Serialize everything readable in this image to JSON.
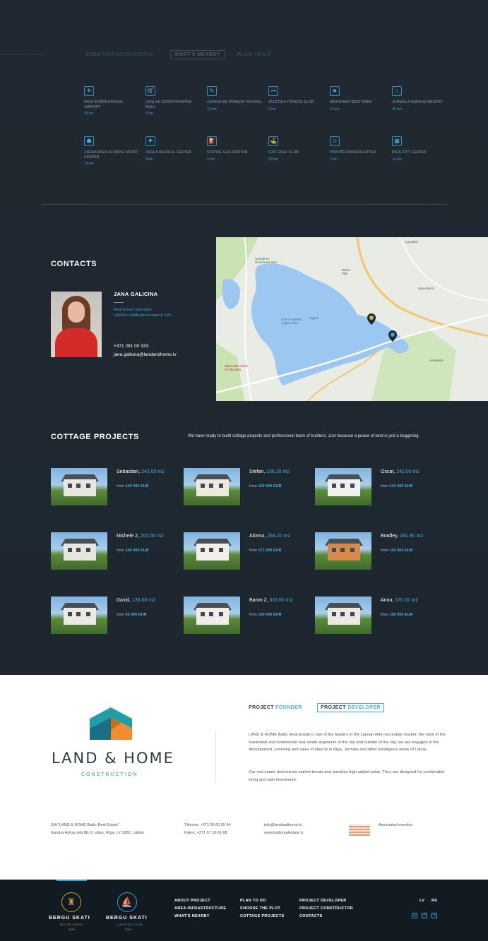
{
  "tabs": [
    {
      "label_a": "AREA",
      "label_b": "INFRASTRUCTURE"
    },
    {
      "label_a": "WHAT'S NEARBY"
    },
    {
      "label_a": "PLAN",
      "label_b": "TO DO"
    }
  ],
  "nearby": [
    {
      "icon": "airplane-icon",
      "glyph": "✈",
      "name": "RIGA INTERNATIONAL AIRPORT",
      "distance": "20 km"
    },
    {
      "icon": "shopping-cart-icon",
      "glyph": "🛒",
      "name": "JUGLAS CENTR SHOPING MALL",
      "distance": "5 km"
    },
    {
      "icon": "school-icon",
      "glyph": "✎",
      "name": "GARKALNE PRIMARY SCHOOL",
      "distance": "13 km"
    },
    {
      "icon": "dumbbell-icon",
      "glyph": "⊶",
      "name": "ATLETIKA FITNESS CLUB",
      "distance": "5 km"
    },
    {
      "icon": "tree-icon",
      "glyph": "♣",
      "name": "MEZAPARK REST PARK",
      "distance": "10 km"
    },
    {
      "icon": "resort-icon",
      "glyph": "⌂",
      "name": "JURMALA FAMOUS RESORT",
      "distance": "35 km"
    },
    {
      "icon": "stadium-icon",
      "glyph": "☗",
      "name": "ARENA RIGA OLYMPIC SPORT CENTER",
      "distance": "15 km"
    },
    {
      "icon": "medical-cross-icon",
      "glyph": "✚",
      "name": "JUGLA MEDICAL CENTER",
      "distance": "5 km"
    },
    {
      "icon": "gas-station-icon",
      "glyph": "⛽",
      "name": "STATOIL GAS STATION",
      "distance": "3 km"
    },
    {
      "icon": "golf-icon",
      "glyph": "⛳",
      "name": "OZO GOLF CLUB",
      "distance": "30 km"
    },
    {
      "icon": "kindergarten-icon",
      "glyph": "☺",
      "name": "PRIVATE KINDERGARTEN",
      "distance": "2 km"
    },
    {
      "icon": "city-icon",
      "glyph": "▦",
      "name": "RIGA CITY CENTER",
      "distance": "14 km"
    }
  ],
  "contacts": {
    "heading": "CONTACTS",
    "name": "JANA GALICINA",
    "role": "Real Estate Specialist",
    "certificate": "LANIDA certificate number A-139",
    "phone": "+371 281 00 333",
    "email": "jana.galicina@landandhome.lv"
  },
  "map": {
    "labels": {
      "pin_a": "Garkalnes\nskriešanas taka",
      "bay": "Ūdens kaisība\nJuglas ezers",
      "lake": "Juglas",
      "gauss": "Gaujas\nezers",
      "pin_b": "Biķernieku mežs\nSmilšu taka",
      "berzu": "Bērzu\nŠķiļi",
      "upesciems": "Upesciems",
      "amatnieki": "Amatnieki",
      "langstini": "Langstiņi"
    }
  },
  "cottage": {
    "heading": "COTTAGE PROJECTS",
    "intro": "We have ready to build cottage projects and professional team of builders. Just because a peace of land is just a beggining.",
    "from_label": "from",
    "projects": [
      {
        "name": "Sebastian,",
        "area": "242.00 m2",
        "price": "145 000 EUR"
      },
      {
        "name": "Stefan,",
        "area": "236.20 m2",
        "price": "142 000 EUR"
      },
      {
        "name": "Oscar,",
        "area": "242.00 m2",
        "price": "141 000 EUR"
      },
      {
        "name": "Michele 2,",
        "area": "253.50 m2",
        "price": "145 000 EUR"
      },
      {
        "name": "Alonso,",
        "area": "284.20 m2",
        "price": "171 000 EUR"
      },
      {
        "name": "Bradley,",
        "area": "291.90 m2",
        "price": "143 000 EUR"
      },
      {
        "name": "David,",
        "area": "136.00 m2",
        "price": "82 000 EUR"
      },
      {
        "name": "Baron 2,",
        "area": "316.60 m2",
        "price": "190 000 EUR"
      },
      {
        "name": "Anna,",
        "area": "170.10 m2",
        "price": "102 000 EUR"
      }
    ]
  },
  "company": {
    "logo_main": "LAND & HOME",
    "logo_sub": "CONSTRUCTION",
    "tab_founder_a": "PROJECT",
    "tab_founder_b": "FOUNDER",
    "tab_dev_a": "PROJECT",
    "tab_dev_b": "DEVELOPER",
    "p1": "LAND & HOME Baltic Real Estate is one of the leaders in the Latvian elite real estate market. We work in the residential and commercial real estate segments of the city and outside of the city: we are engaged in the development, servicing and sales of objects in Riga, Jurmala and other prestigious areas of Latvia.",
    "p2": "Our real estate determines market trends and provides high added value. They are designed for comfortable living and safe investment.",
    "legal1": "SIA \"LAND & HOME Baltic Real Estate\"",
    "legal2": "Gunāra Astras iela 8b, 8. stāvs, Rīga, LV 1082, Latvija",
    "tel": "Tālrunis: +371 26 60 55 44",
    "fax": "Fakss: +371 67 18 66 68",
    "email": "info@landandhome.lv",
    "web": "www.balticrealestate.lv",
    "associated": "Associated member"
  },
  "footer": {
    "brand1": {
      "name": "BERGU SKATI",
      "sub": "BIT OF SWISS",
      "year": "2014"
    },
    "brand2": {
      "name": "BERGU SKATI",
      "sub": "LAKESIDE CLUB",
      "year": "2019"
    },
    "col1": [
      "ABOUT PROJECT",
      "AREA INFRASTRUCTURE",
      "WHAT'S NEARBY"
    ],
    "col2": [
      "PLAN TO DO",
      "CHOOSE THE PLOT",
      "COTTAGE PROJECTS"
    ],
    "col3": [
      "PROJECT DEVELOPER",
      "PROJECT CONSTRUCTOR",
      "CONTACTS"
    ],
    "lang": [
      "LV",
      "RU"
    ],
    "social": [
      {
        "icon": "instagram-icon",
        "glyph": "◎"
      },
      {
        "icon": "phone-icon",
        "glyph": "✆"
      },
      {
        "icon": "email-icon",
        "glyph": "✉"
      }
    ]
  }
}
